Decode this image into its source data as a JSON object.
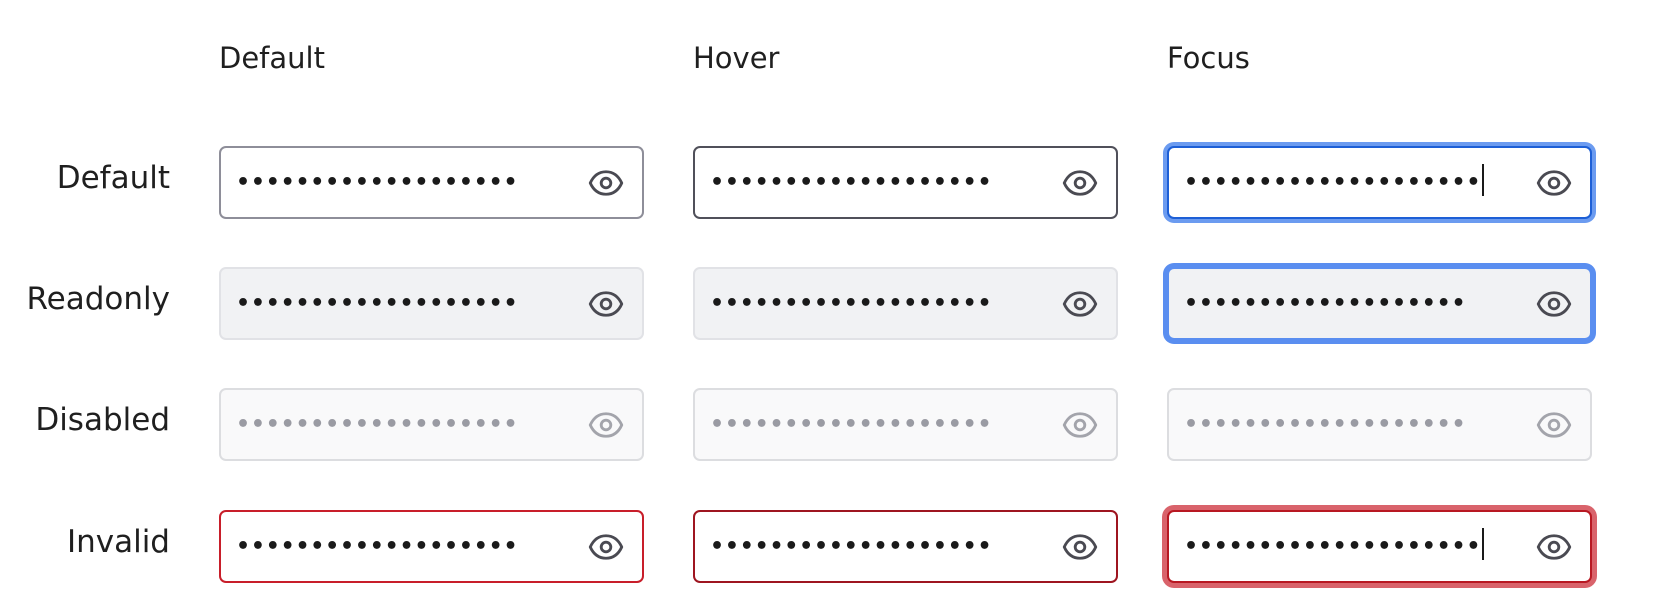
{
  "columns": {
    "default": "Default",
    "hover": "Hover",
    "focus": "Focus"
  },
  "rows": {
    "default": "Default",
    "readonly": "Readonly",
    "disabled": "Disabled",
    "invalid": "Invalid"
  },
  "password_mask": "•••••••••••••••••••",
  "password_mask_focus": "••••••••••••••••••••",
  "icons": {
    "toggle": "eye-icon"
  },
  "colors": {
    "border_default": "#8e8e99",
    "border_hover": "#50505a",
    "focus_ring": "#6b9bf0",
    "readonly_bg": "#f1f2f4",
    "disabled_bg": "#f9f9fa",
    "invalid": "#c81e2a",
    "invalid_ring": "#d9636b"
  }
}
